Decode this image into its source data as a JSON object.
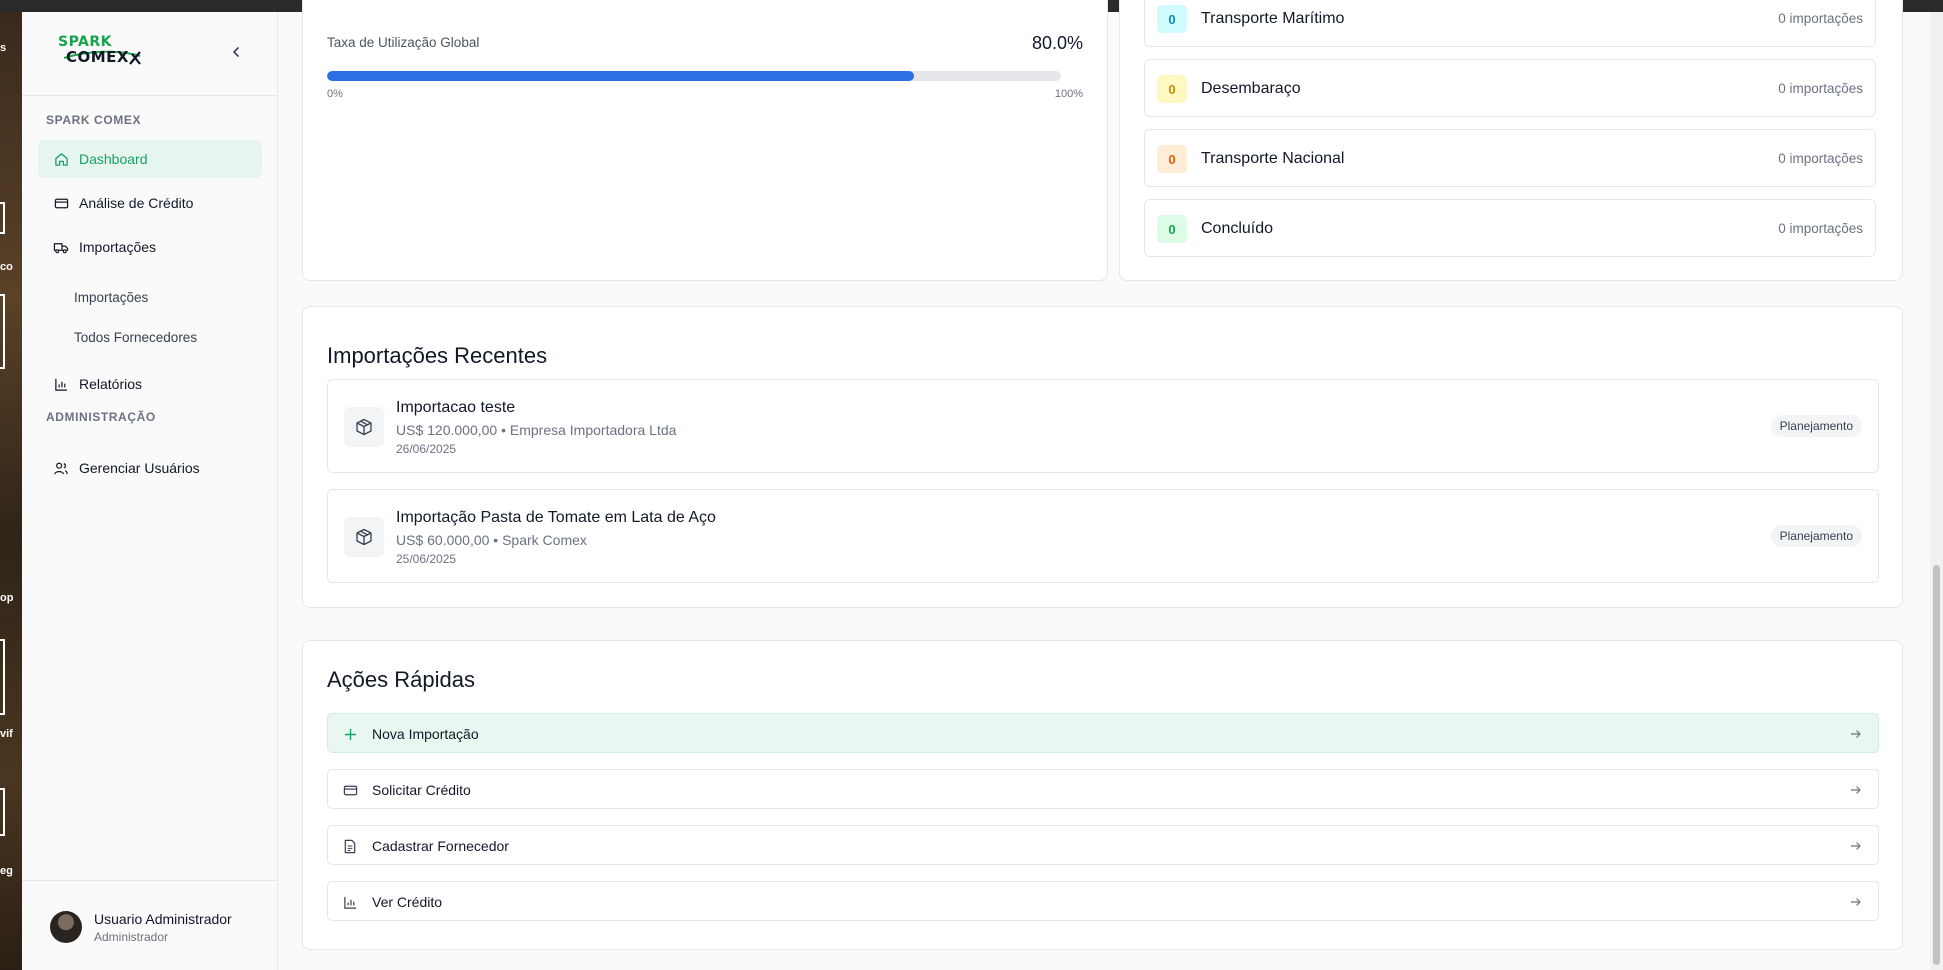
{
  "sidebar": {
    "logo_line1": "SPARK",
    "logo_line2": "COMEX",
    "section_main": "SPARK COMEX",
    "section_admin": "ADMINISTRAÇÃO",
    "items": {
      "dashboard": "Dashboard",
      "credit_analysis": "Análise de Crédito",
      "imports": "Importações",
      "imports_sub": "Importações",
      "suppliers_sub": "Todos Fornecedores",
      "reports": "Relatórios",
      "manage_users": "Gerenciar Usuários"
    },
    "user": {
      "name": "Usuario Administrador",
      "role": "Administrador"
    }
  },
  "utilization": {
    "label": "Taxa de Utilização Global",
    "value_text": "80.0%",
    "fill_fraction": 0.8,
    "min_label": "0%",
    "max_label": "100%"
  },
  "stages": [
    {
      "count": "0",
      "name": "Transporte Marítimo",
      "imports": "0 importações",
      "badge_bg": "#cffafe",
      "badge_fg": "#0891b2"
    },
    {
      "count": "0",
      "name": "Desembaraço",
      "imports": "0 importações",
      "badge_bg": "#fef9c3",
      "badge_fg": "#ca8a04"
    },
    {
      "count": "0",
      "name": "Transporte Nacional",
      "imports": "0 importações",
      "badge_bg": "#ffedd5",
      "badge_fg": "#ea580c"
    },
    {
      "count": "0",
      "name": "Concluído",
      "imports": "0 importações",
      "badge_bg": "#dcfce7",
      "badge_fg": "#16a34a"
    }
  ],
  "recent_imports": {
    "title": "Importações Recentes",
    "items": [
      {
        "title": "Importacao teste",
        "meta": "US$ 120.000,00 • Empresa Importadora Ltda",
        "date": "26/06/2025",
        "status": "Planejamento",
        "icon": "package-icon"
      },
      {
        "title": "Importação Pasta de Tomate em Lata de Aço",
        "meta": "US$ 60.000,00 • Spark Comex",
        "date": "25/06/2025",
        "status": "Planejamento",
        "icon": "package-icon"
      }
    ]
  },
  "quick_actions": {
    "title": "Ações Rápidas",
    "items": [
      {
        "label": "Nova Importação",
        "icon": "plus-icon"
      },
      {
        "label": "Solicitar Crédito",
        "icon": "credit-card-icon"
      },
      {
        "label": "Cadastrar Fornecedor",
        "icon": "file-text-icon"
      },
      {
        "label": "Ver Crédito",
        "icon": "bar-chart-icon"
      }
    ]
  },
  "desktop_fragments": [
    "s",
    "co",
    "op",
    "vif",
    "eg"
  ],
  "colors": {
    "accent_green": "#16a06a",
    "progress_blue": "#2b6fe3"
  }
}
